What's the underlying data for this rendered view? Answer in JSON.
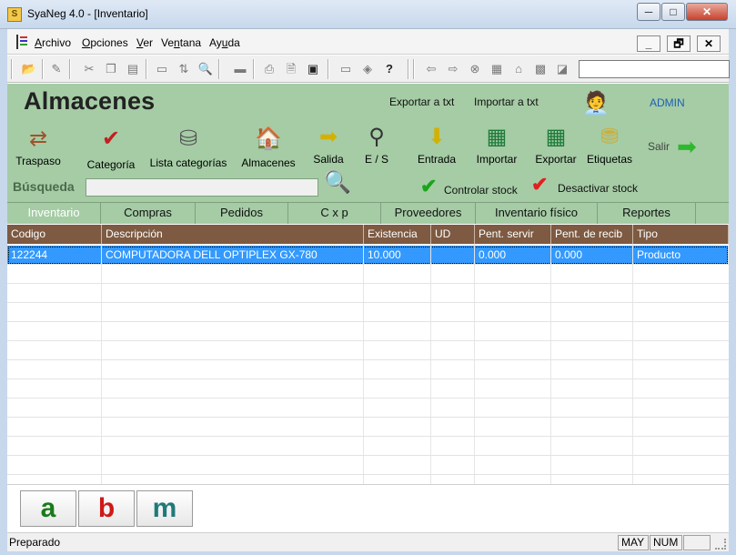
{
  "window": {
    "title": "SyaNeg 4.0 - [Inventario]",
    "icon": "app-icon-s",
    "minimize": "─",
    "maximize": "□",
    "close": "✕"
  },
  "menu": {
    "items": [
      {
        "pre": "",
        "u": "A",
        "post": "rchivo"
      },
      {
        "pre": "",
        "u": "O",
        "post": "pciones"
      },
      {
        "pre": "",
        "u": "V",
        "post": "er"
      },
      {
        "pre": "Ve",
        "u": "n",
        "post": "tana"
      },
      {
        "pre": "Ay",
        "u": "u",
        "post": "da"
      }
    ],
    "mdi": {
      "minimize": "_",
      "restore": "🗗",
      "close": "✕"
    }
  },
  "toolbar": {
    "icons": [
      "open-folder",
      "edit-doc",
      "cut",
      "copy",
      "paste",
      "window",
      "swap",
      "search",
      "scanner",
      "print",
      "print-preview",
      "page",
      "monitor",
      "stack",
      "help",
      "back",
      "forward",
      "stop",
      "calc",
      "home",
      "records",
      "filter"
    ]
  },
  "panel": {
    "title": "Almacenes",
    "export_txt": "Exportar a txt",
    "import_txt": "Importar a txt",
    "user": "ADMIN",
    "tools": {
      "traspaso": "Traspaso",
      "categoria": "Categoría",
      "lista_categorias": "Lista categorías",
      "almacenes": "Almacenes",
      "salida": "Salida",
      "es": "E / S",
      "entrada": "Entrada",
      "importar": "Importar",
      "exportar": "Exportar",
      "etiquetas": "Etiquetas",
      "salir": "Salir"
    },
    "search_label": "Búsqueda",
    "search_value": "",
    "controlar_stock": "Controlar stock",
    "desactivar_stock": "Desactivar stock",
    "colors": {
      "panel": "#a5cca5",
      "check_green": "#1aa51a",
      "check_red": "#e02020",
      "admin": "#1e5fb4"
    }
  },
  "tabs": [
    "Inventario",
    "Compras",
    "Pedidos",
    "C x p",
    "Proveedores",
    "Inventario físico",
    "Reportes"
  ],
  "grid": {
    "columns": [
      "Codigo",
      "Descripción",
      "Existencia",
      "UD",
      "Pent. servir",
      "Pent. de recib",
      "Tipo"
    ],
    "rows": [
      [
        "122244",
        "COMPUTADORA DELL OPTIPLEX GX-780",
        "10.000",
        "",
        "0.000",
        "0.000",
        "Producto"
      ]
    ],
    "header_color": "#7d5a41",
    "selected_color": "#3399ff"
  },
  "bottom_buttons": [
    {
      "label": "a",
      "color": "#1a7a1a"
    },
    {
      "label": "b",
      "color": "#d01818"
    },
    {
      "label": "m",
      "color": "#1f7a7a"
    }
  ],
  "status": {
    "text": "Preparado",
    "may": "MAY",
    "num": "NUM"
  }
}
